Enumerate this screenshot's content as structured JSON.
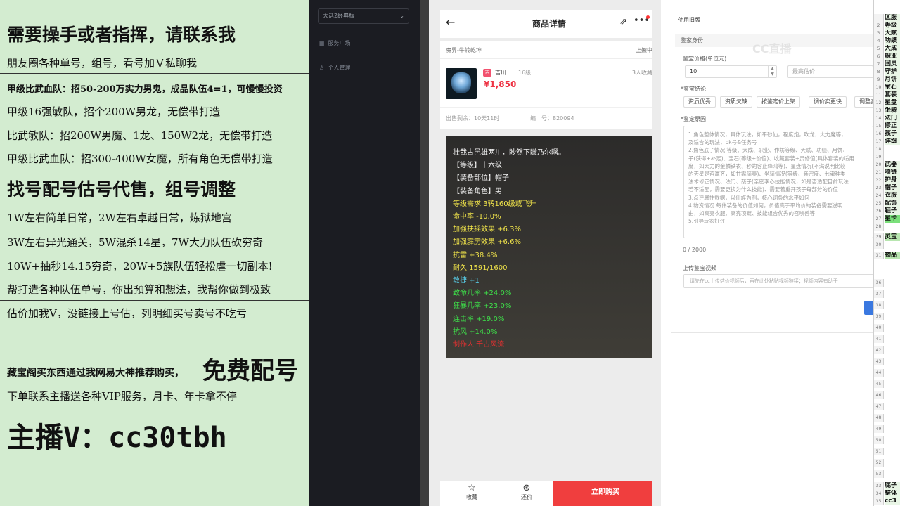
{
  "overlay": {
    "l1": "需要操手或者指挥，请联系我",
    "l2": "朋友圈各种单号，组号，看号加Ｖ私聊我",
    "l3": "甲级比武血队：招50-200万实力男鬼，成品队伍4=1，可慢慢投资",
    "l4": "甲级16强敏队，招个200W男龙，无偿带打造",
    "l5": "比武敏队：招200W男魔、1龙、150W2龙，无偿带打造",
    "l6": "甲级比武血队：招300-400W女魔，所有角色无偿带打造",
    "l7": "找号配号估号代售，组号调整",
    "l8": "1W左右简单日常，2W左右卓越日常，炼狱地宫",
    "l9": "3W左右异光通关，5W混杀14星，7W大力队伍砍穷奇",
    "l10": "10W+抽秒14.15穷奇，20W+5族队伍轻松虐一切副本!",
    "l11": "帮打造各种队伍单号，你出预算和想法，我帮你做到极致",
    "l12": "估价加我V，没链接上号估，列明细买号卖号不吃亏",
    "l13": "藏宝阁买东西通过我网易大神推荐购买，",
    "l13b": "免费配号",
    "l14": "下单联系主播送各种VIP服务，月卡、年卡拿不停",
    "l15": "主播V：cc30tbh"
  },
  "sidebar": {
    "select": "大话2经典版",
    "items": [
      "服务广场",
      "个人管理"
    ]
  },
  "phone": {
    "title": "商品详情",
    "server": "魔界-牛转乾坤",
    "status": "上架中",
    "badge": "吉",
    "seller": "吉川",
    "level": "16级",
    "favorites": "3人收藏",
    "price": "¥1,850",
    "remain": "出售剩余：10天11时",
    "code": "编　号：820094",
    "tooltip": [
      {
        "text": "壮哉古邑雄两川，眇然下瞰乃尔曙。",
        "color": "#f2f2f2"
      },
      {
        "text": "【等级】十六级",
        "color": "#f2f2f2"
      },
      {
        "text": "【装备部位】帽子",
        "color": "#f2f2f2"
      },
      {
        "text": "【装备角色】男",
        "color": "#f2f2f2"
      },
      {
        "text": "等级需求 3转160级或飞升",
        "color": "#f0e34a"
      },
      {
        "text": "命中率 -10.0%",
        "color": "#f0e34a"
      },
      {
        "text": "加强扶摇效果 +6.3%",
        "color": "#f0e34a"
      },
      {
        "text": "加强霹雳效果 +6.6%",
        "color": "#f0e34a"
      },
      {
        "text": "抗雷 +38.4%",
        "color": "#f0e34a"
      },
      {
        "text": "耐久 1591/1600",
        "color": "#f0e34a"
      },
      {
        "text": "敏捷 +1",
        "color": "#5ad4f0"
      },
      {
        "text": "致命几率 +24.0%",
        "color": "#3ee04a"
      },
      {
        "text": "狂暴几率 +23.0%",
        "color": "#3ee04a"
      },
      {
        "text": "连击率 +19.0%",
        "color": "#3ee04a"
      },
      {
        "text": "抗风 +14.0%",
        "color": "#3ee04a"
      },
      {
        "text": "制作人 千古风流",
        "color": "#e83030"
      }
    ],
    "collect": "收藏",
    "bargain": "还价",
    "buy": "立即购买"
  },
  "form": {
    "tab": "使用旧版",
    "section": "鉴家身份",
    "price_label": "鉴宝价格(单位元)",
    "price_value": "10",
    "estimate_placeholder": "最高估价",
    "conclusion_label": "*鉴宝结论",
    "chips": [
      "资质优秀",
      "资质欠缺",
      "按鉴定价上架",
      "调价卖更快",
      "调整卖"
    ],
    "reason_label": "*鉴定原因",
    "reason_lines": [
      "1.角色整体情况，具体玩法，如平砂仙，程度炮，吹龙，大力魔等，",
      "及适合的玩法，pk号&任务号",
      "2.角色底子情况 等级、大成、职业、作坊等级、天赋、功绩、月饼、",
      "子(获得+补足)、宝石(等级+价值)、收藏套装+灵修值(具体套装的适用",
      "度，如大力的金麟铁衣、秒的容止绛鸿等)、星盘情况(不满说明比较",
      "的天星是否赢齐，如甘霖骑奏)、坐骑情况(等级、亲密度、七魂种类",
      "法术修正情况、法门、孩子(亲密李心技能情况，如是否适配目前玩法",
      "若不适配，需要更换为什么技能)、需要着重开孩子每部分的价值",
      "3.点评属性数据，以仙族为例，核心词条的水平如何",
      "4.物资情况 每件装备的价值如何，价值高于平均价的装备需要说明",
      "由，如高亮衣服、高亮项链、技能组合优秀的召唤兽等",
      "5.引导玩家好评"
    ],
    "count": "0 / 2000",
    "video_label": "上传鉴宝视频",
    "video_placeholder": "请先在cc上传估价视频后，再在此处粘贴视频链接；视频内容有助于",
    "watermark": "CC直播"
  },
  "sheet": {
    "rows": [
      {
        "n": "",
        "t": "区服"
      },
      {
        "n": "2",
        "t": "等级"
      },
      {
        "n": "3",
        "t": "天赋"
      },
      {
        "n": "4",
        "t": "功绩"
      },
      {
        "n": "5",
        "t": "大成"
      },
      {
        "n": "6",
        "t": "职业"
      },
      {
        "n": "7",
        "t": "回灵"
      },
      {
        "n": "8",
        "t": "守护"
      },
      {
        "n": "9",
        "t": "月饼"
      },
      {
        "n": "10",
        "t": "宝石"
      },
      {
        "n": "11",
        "t": "套装"
      },
      {
        "n": "12",
        "t": "星盘"
      },
      {
        "n": "13",
        "t": "坐骑"
      },
      {
        "n": "14",
        "t": "法门"
      },
      {
        "n": "15",
        "t": "修正"
      },
      {
        "n": "16",
        "t": "孩子"
      },
      {
        "n": "17",
        "t": "详细"
      },
      {
        "n": "18",
        "t": ""
      },
      {
        "n": "19",
        "t": ""
      },
      {
        "n": "20",
        "t": "武器"
      },
      {
        "n": "21",
        "t": "项链"
      },
      {
        "n": "22",
        "t": "护身"
      },
      {
        "n": "23",
        "t": "帽子"
      },
      {
        "n": "24",
        "t": "衣服"
      },
      {
        "n": "25",
        "t": "配饰"
      },
      {
        "n": "26",
        "t": "鞋子"
      },
      {
        "n": "27",
        "t": "星卡"
      },
      {
        "n": "28",
        "t": ""
      },
      {
        "n": "29",
        "t": "灵宝"
      },
      {
        "n": "30",
        "t": ""
      },
      {
        "n": "31",
        "t": "物品"
      }
    ],
    "bottom": [
      {
        "n": "33",
        "t": "底子"
      },
      {
        "n": "34",
        "t": "整体"
      },
      {
        "n": "35",
        "t": "cc3"
      }
    ],
    "empty_rows": [
      "36",
      "37",
      "38",
      "39",
      "40",
      "41",
      "42",
      "43",
      "44",
      "45",
      "46",
      "47",
      "48",
      "49",
      "50",
      "51",
      "52",
      "53"
    ]
  }
}
